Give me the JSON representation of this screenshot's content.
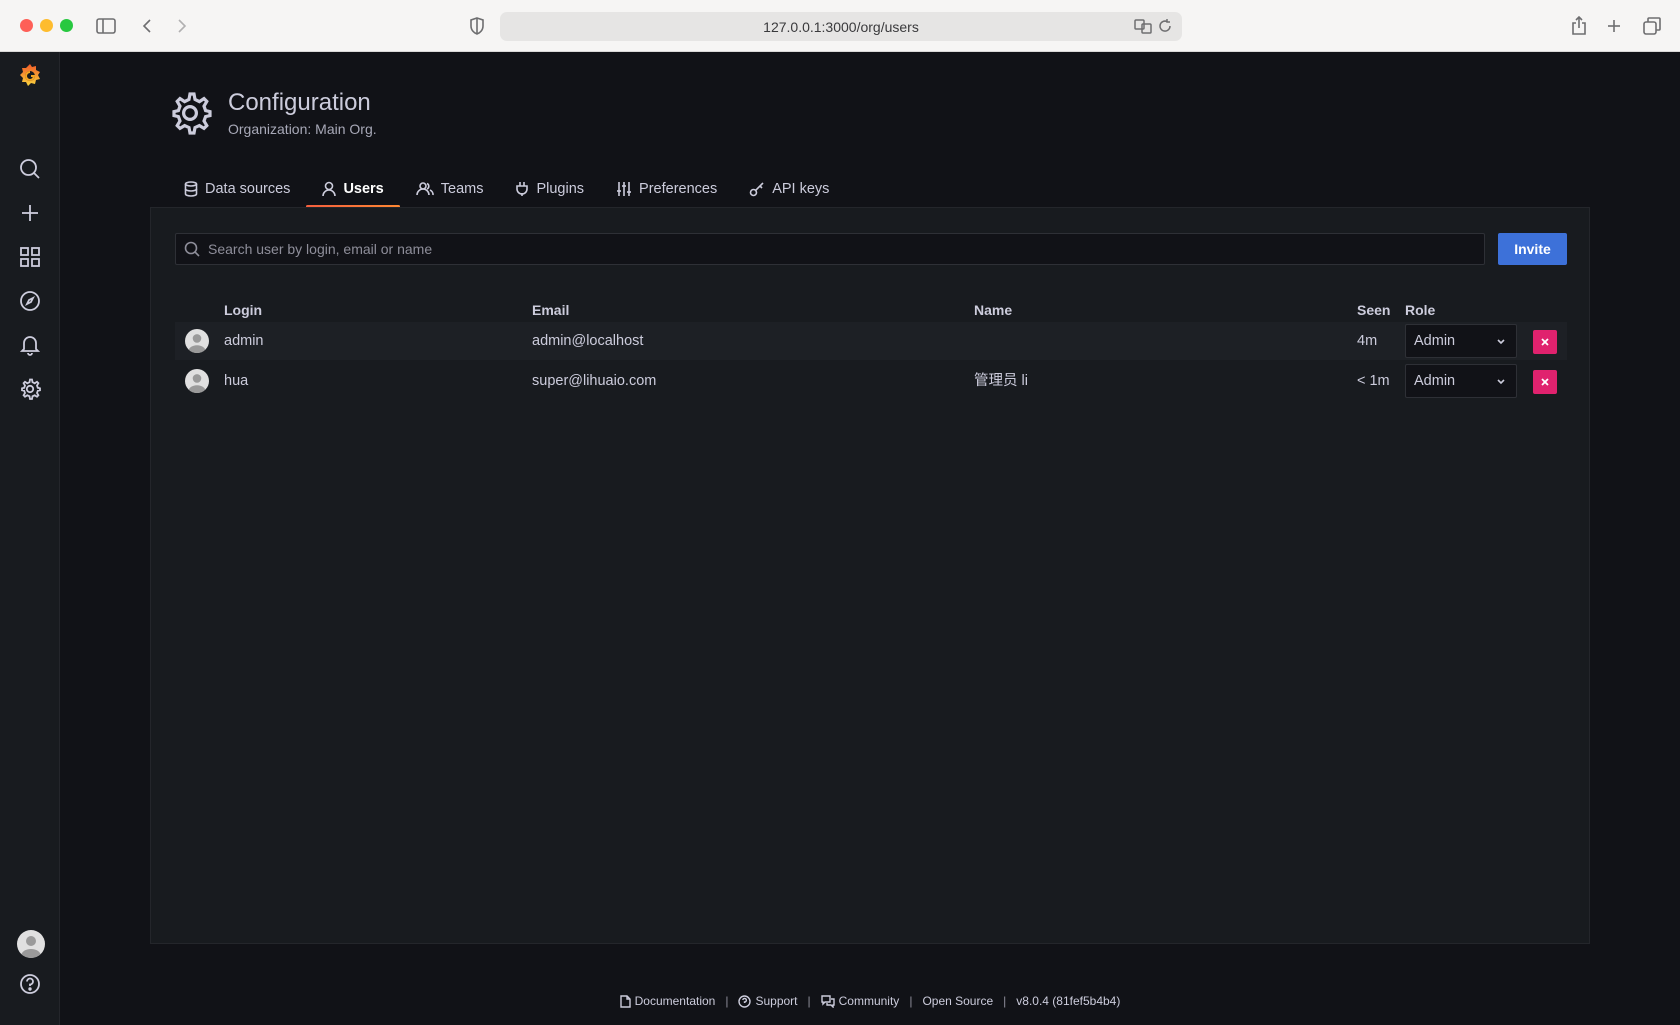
{
  "browser": {
    "url": "127.0.0.1:3000/org/users"
  },
  "header": {
    "title": "Configuration",
    "subtitle": "Organization: Main Org."
  },
  "tabs": [
    {
      "label": "Data sources",
      "icon": "database-icon"
    },
    {
      "label": "Users",
      "icon": "user-icon",
      "active": true
    },
    {
      "label": "Teams",
      "icon": "users-icon"
    },
    {
      "label": "Plugins",
      "icon": "plug-icon"
    },
    {
      "label": "Preferences",
      "icon": "sliders-icon"
    },
    {
      "label": "API keys",
      "icon": "key-icon"
    }
  ],
  "search": {
    "placeholder": "Search user by login, email or name"
  },
  "invite_label": "Invite",
  "table": {
    "headers": {
      "login": "Login",
      "email": "Email",
      "name": "Name",
      "seen": "Seen",
      "role": "Role"
    },
    "rows": [
      {
        "login": "admin",
        "email": "admin@localhost",
        "name": "",
        "seen": "4m",
        "role": "Admin"
      },
      {
        "login": "hua",
        "email": "super@lihuaio.com",
        "name": "管理员 li",
        "seen": "< 1m",
        "role": "Admin"
      }
    ]
  },
  "footer": {
    "documentation": "Documentation",
    "support": "Support",
    "community": "Community",
    "open_source": "Open Source",
    "version": "v8.0.4 (81fef5b4b4)"
  },
  "colors": {
    "accent": "#3d71d9",
    "danger": "#e0226e",
    "tab_active": "#ff8833"
  }
}
